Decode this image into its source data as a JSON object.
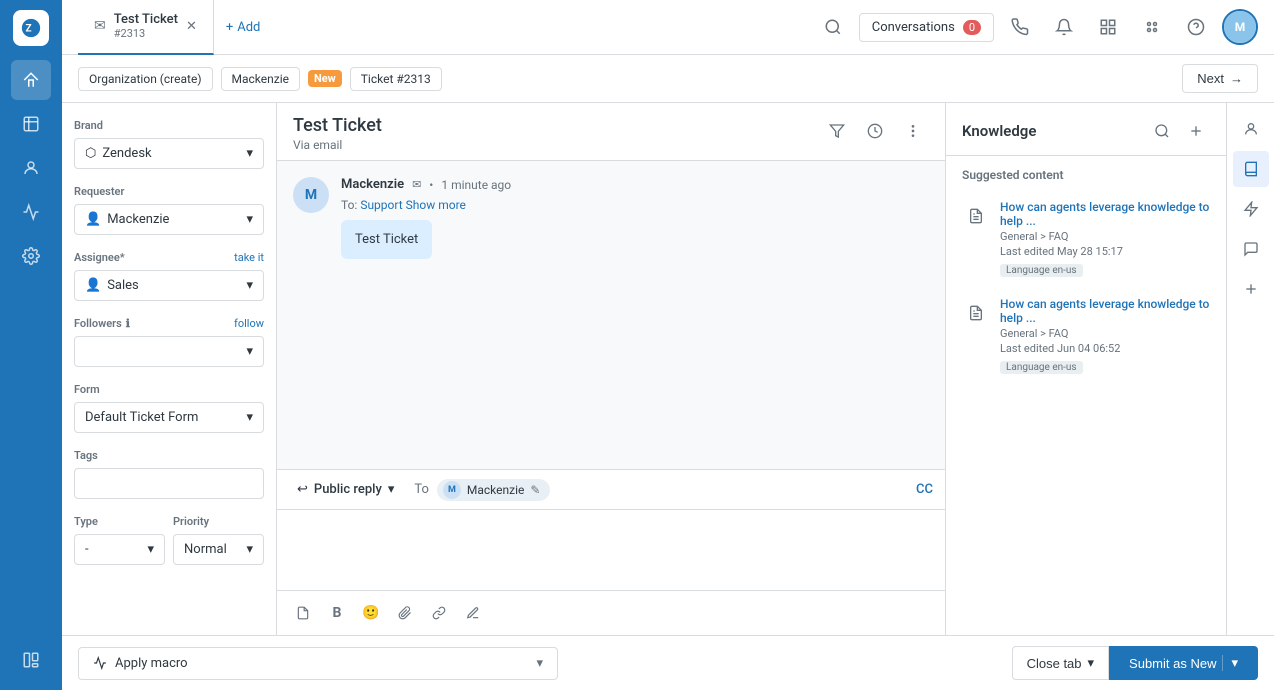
{
  "app": {
    "logo_text": "Z"
  },
  "nav": {
    "icons": [
      "home",
      "tickets",
      "contacts",
      "reports",
      "settings",
      "templates"
    ]
  },
  "topbar": {
    "tab_title": "Test Ticket",
    "tab_subtitle": "#2313",
    "add_label": "Add",
    "conversations_label": "Conversations",
    "conversations_count": "0"
  },
  "breadcrumb": {
    "org_label": "Organization (create)",
    "contact_label": "Mackenzie",
    "status_badge": "New",
    "ticket_label": "Ticket #2313",
    "next_label": "Next"
  },
  "sidebar": {
    "brand_label": "Brand",
    "brand_value": "Zendesk",
    "requester_label": "Requester",
    "requester_value": "Mackenzie",
    "assignee_label": "Assignee*",
    "assignee_take_it": "take it",
    "assignee_value": "Sales",
    "followers_label": "Followers",
    "followers_follow": "follow",
    "form_label": "Form",
    "form_value": "Default Ticket Form",
    "tags_label": "Tags",
    "type_label": "Type",
    "type_value": "-",
    "priority_label": "Priority",
    "priority_value": "Normal"
  },
  "ticket": {
    "title": "Test Ticket",
    "via": "Via email",
    "message_sender": "Mackenzie",
    "message_time": "1 minute ago",
    "message_to": "Support",
    "message_show_more": "Show more",
    "message_body": "Test Ticket"
  },
  "reply": {
    "type_label": "Public reply",
    "to_label": "To",
    "recipient_name": "Mackenzie",
    "cc_label": "CC"
  },
  "knowledge": {
    "title": "Knowledge",
    "suggested_label": "Suggested content",
    "items": [
      {
        "title": "How can agents leverage knowledge to help ...",
        "category": "General > FAQ",
        "date": "Last edited May 28 15:17",
        "language": "Language en-us"
      },
      {
        "title": "How can agents leverage knowledge to help ...",
        "category": "General > FAQ",
        "date": "Last edited Jun 04 06:52",
        "language": "Language en-us"
      }
    ]
  },
  "bottom": {
    "apply_macro_label": "Apply macro",
    "close_tab_label": "Close tab",
    "submit_label": "Submit as New"
  }
}
